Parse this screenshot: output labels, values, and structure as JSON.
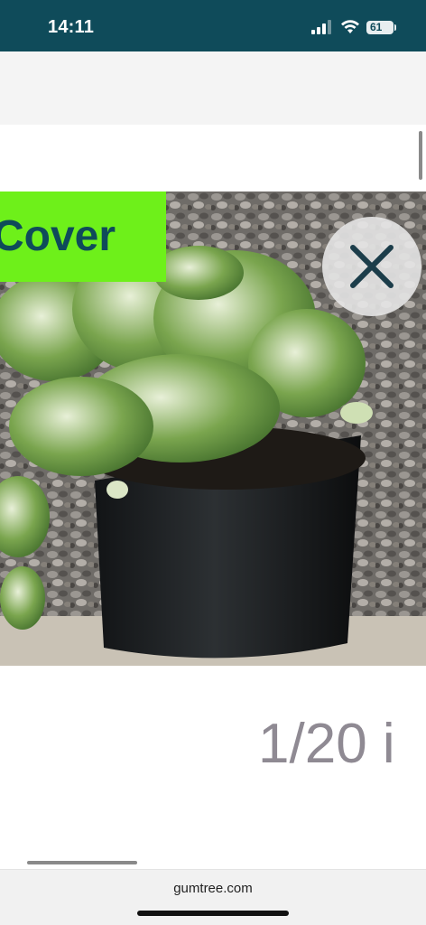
{
  "status_bar": {
    "time": "14:11",
    "battery_level": "61",
    "icons": [
      "signal-icon",
      "wifi-icon",
      "battery-icon"
    ]
  },
  "gallery": {
    "badge_label": "Cover",
    "counter_text": "1/20 i",
    "close_icon": "close-icon",
    "image": "potted-plant-photo"
  },
  "browser": {
    "domain": "gumtree.com"
  },
  "colors": {
    "status_bar_bg": "#0f4b5a",
    "badge_bg": "#6ef01a",
    "badge_text": "#0f4b5a",
    "counter_text": "#8f8a93"
  }
}
